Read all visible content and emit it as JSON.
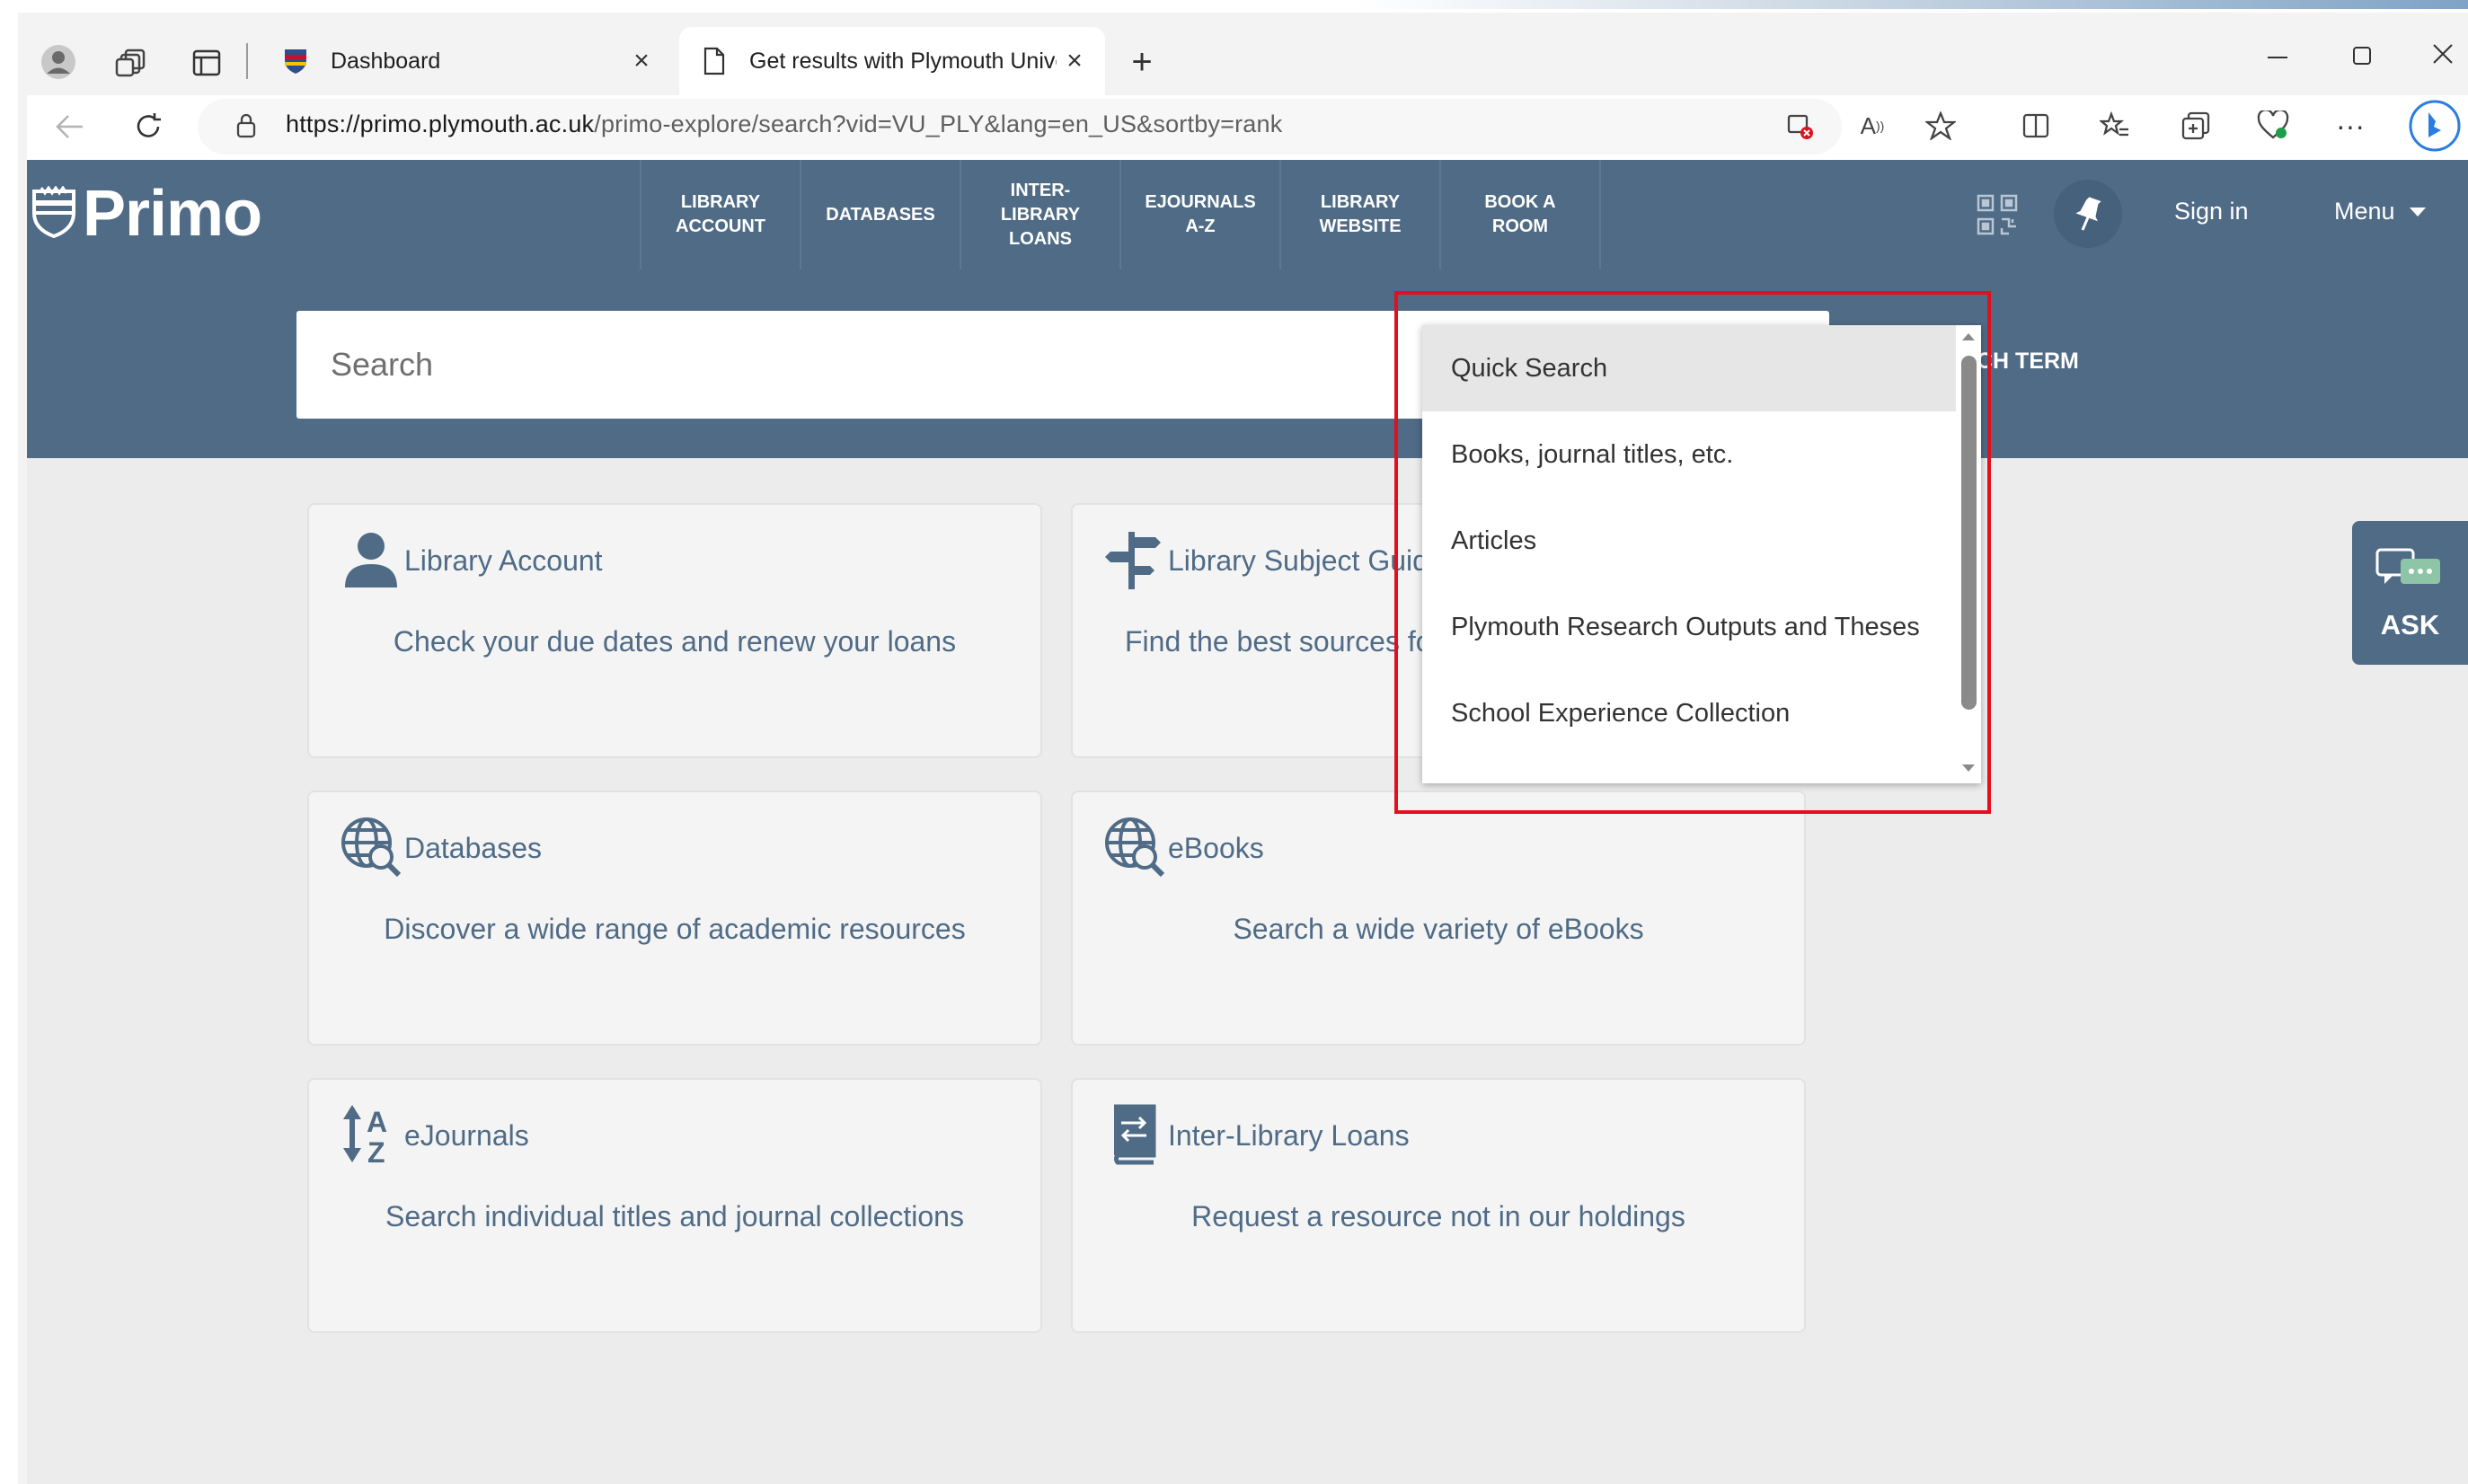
{
  "browser": {
    "tabs": [
      {
        "title": "Dashboard",
        "close": "×"
      },
      {
        "title": "Get results with Plymouth Univer",
        "close": "×"
      }
    ],
    "new_tab": "+",
    "url_host": "https://primo.plymouth.ac.uk",
    "url_path": "/primo-explore/search?vid=VU_PLY&lang=en_US&sortby=rank",
    "window_controls": [
      "minimize",
      "maximize",
      "close"
    ]
  },
  "header": {
    "logo": "Primo",
    "nav": [
      "LIBRARY\nACCOUNT",
      "DATABASES",
      "INTER-\nLIBRARY\nLOANS",
      "EJOURNALS\nA-Z",
      "LIBRARY\nWEBSITE",
      "BOOK A\nROOM"
    ],
    "sign_in": "Sign in",
    "menu": "Menu"
  },
  "search": {
    "placeholder": "Search",
    "button_partial": "CH TERM"
  },
  "scope_dropdown": {
    "options": [
      "Quick Search",
      "Books, journal titles, etc.",
      "Articles",
      "Plymouth Research Outputs and Theses",
      "School Experience Collection"
    ],
    "selected": "Quick Search"
  },
  "tiles": [
    {
      "title": "Library Account",
      "desc": "Check your due dates and renew your loans",
      "icon": "person-icon"
    },
    {
      "title": "Library Subject Guid",
      "desc": "Find the best sources fo",
      "icon": "signpost-icon"
    },
    {
      "title": "Databases",
      "desc": "Discover a wide range of academic resources",
      "icon": "globe-search-icon"
    },
    {
      "title": "eBooks",
      "desc": "Search a wide variety of eBooks",
      "icon": "globe-search-icon"
    },
    {
      "title": "eJournals",
      "desc": "Search individual titles and journal collections",
      "icon": "sort-az-icon"
    },
    {
      "title": "Inter-Library Loans",
      "desc": "Request a resource not in our holdings",
      "icon": "book-exchange-icon"
    }
  ],
  "ask": {
    "label": "ASK"
  },
  "colors": {
    "brand": "#4f6b86",
    "highlight": "#e0101f"
  }
}
